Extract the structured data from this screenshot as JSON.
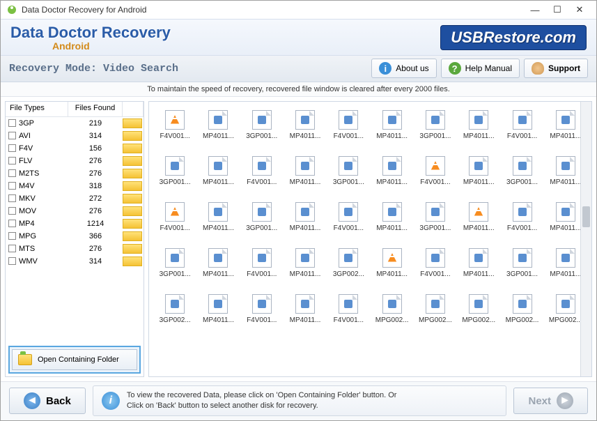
{
  "window": {
    "title": "Data Doctor Recovery for Android"
  },
  "brand": {
    "title": "Data Doctor Recovery",
    "subtitle": "Android",
    "logo": "USBRestore.com"
  },
  "toolbar": {
    "mode": "Recovery Mode: Video Search",
    "about": "About us",
    "help": "Help Manual",
    "support": "Support"
  },
  "info_strip": "To maintain the speed of recovery, recovered file window is cleared after every 2000 files.",
  "file_types": {
    "header": {
      "col1": "File Types",
      "col2": "Files Found"
    },
    "rows": [
      {
        "type": "3GP",
        "count": 219
      },
      {
        "type": "AVI",
        "count": 314
      },
      {
        "type": "F4V",
        "count": 156
      },
      {
        "type": "FLV",
        "count": 276
      },
      {
        "type": "M2TS",
        "count": 276
      },
      {
        "type": "M4V",
        "count": 318
      },
      {
        "type": "MKV",
        "count": 272
      },
      {
        "type": "MOV",
        "count": 276
      },
      {
        "type": "MP4",
        "count": 1214
      },
      {
        "type": "MPG",
        "count": 366
      },
      {
        "type": "MTS",
        "count": 276
      },
      {
        "type": "WMV",
        "count": 314
      }
    ]
  },
  "open_folder": "Open Containing Folder",
  "grid": {
    "rows": [
      [
        "F4V001...",
        "MP4011...",
        "3GP001...",
        "MP4011...",
        "F4V001...",
        "MP4011...",
        "3GP001...",
        "MP4011...",
        "F4V001...",
        "MP4011..."
      ],
      [
        "3GP001...",
        "MP4011...",
        "F4V001...",
        "MP4011...",
        "3GP001...",
        "MP4011...",
        "F4V001...",
        "MP4011...",
        "3GP001...",
        "MP4011..."
      ],
      [
        "F4V001...",
        "MP4011...",
        "3GP001...",
        "MP4011...",
        "F4V001...",
        "MP4011...",
        "3GP001...",
        "MP4011...",
        "F4V001...",
        "MP4011..."
      ],
      [
        "3GP001...",
        "MP4011...",
        "F4V001...",
        "MP4011...",
        "3GP002...",
        "MP4011...",
        "F4V001...",
        "MP4011...",
        "3GP001...",
        "MP4011..."
      ],
      [
        "3GP002...",
        "MP4011...",
        "F4V001...",
        "MP4011...",
        "F4V001...",
        "MPG002...",
        "MPG002...",
        "MPG002...",
        "MPG002...",
        "MPG002..."
      ]
    ],
    "cone_positions": [
      [
        0,
        0
      ],
      [
        1,
        6
      ],
      [
        2,
        0
      ],
      [
        2,
        7
      ],
      [
        3,
        5
      ]
    ]
  },
  "footer": {
    "back": "Back",
    "next": "Next",
    "msg_l1": "To view the recovered Data, please click on 'Open Containing Folder' button. Or",
    "msg_l2": "Click on 'Back' button to select another disk for recovery."
  }
}
